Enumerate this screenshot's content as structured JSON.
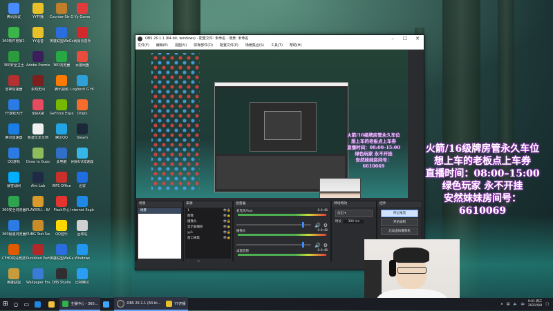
{
  "desktop": {
    "icons": [
      {
        "label": "腾讯会议",
        "color": "#4a8cff"
      },
      {
        "label": "YY开播",
        "color": "#e8c02a"
      },
      {
        "label": "Counter-Str Global Off...",
        "color": "#c07d2a"
      },
      {
        "label": "Yy Game",
        "color": "#e23b3b"
      },
      {
        "label": "360软件管家2.0",
        "color": "#3bb54a"
      },
      {
        "label": "YY语音",
        "color": "#e8c02a"
      },
      {
        "label": "英雄联盟WeGame",
        "color": "#2b6cdf"
      },
      {
        "label": "网易云音乐",
        "color": "#d3282c"
      },
      {
        "label": "360安全卫士",
        "color": "#2c9b3e"
      },
      {
        "label": "Adobe Premiere...",
        "color": "#3a1f5c"
      },
      {
        "label": "360浏览器",
        "color": "#28a745"
      },
      {
        "label": "百度网盘",
        "color": "#e94b3c"
      },
      {
        "label": "雷神加速器",
        "color": "#b53030"
      },
      {
        "label": "永劫无间",
        "color": "#7c1f1f"
      },
      {
        "label": "腾讯视频",
        "color": "#ff7a00"
      },
      {
        "label": "Logitech G HUB",
        "color": "#2f9fd8"
      },
      {
        "label": "YY游戏大厅",
        "color": "#2b7be4"
      },
      {
        "label": "全民K歌",
        "color": "#e84a5f"
      },
      {
        "label": "GeForce Experience",
        "color": "#76b900"
      },
      {
        "label": "Origin",
        "color": "#f56c2d"
      },
      {
        "label": "腾讯加速器",
        "color": "#1a7ee6"
      },
      {
        "label": "新建文本文档",
        "color": "#f0f0f0"
      },
      {
        "label": "腾讯QQ",
        "color": "#23a4e4"
      },
      {
        "label": "Steam",
        "color": "#1b2838"
      },
      {
        "label": "QQ游戏",
        "color": "#2c7be5"
      },
      {
        "label": "Draw to Guess",
        "color": "#8fbc5a"
      },
      {
        "label": "此电脑",
        "color": "#2f6fc7"
      },
      {
        "label": "网易UU加速器",
        "color": "#35b6e6"
      },
      {
        "label": "暴雪战网",
        "color": "#00aeff"
      },
      {
        "label": "Aim Lab",
        "color": "#1f2a44"
      },
      {
        "label": "WPS Office",
        "color": "#c8302b"
      },
      {
        "label": "迅雷",
        "color": "#1f6de0"
      },
      {
        "label": "360安全浏览器",
        "color": "#2ea44f"
      },
      {
        "label": "PLAYERU... BATTLEGR...",
        "color": "#d79a2b"
      },
      {
        "label": "Flash中心",
        "color": "#e3342f"
      },
      {
        "label": "Internet Explorer",
        "color": "#1e88e5"
      },
      {
        "label": "360极速浏览器",
        "color": "#2c7be5"
      },
      {
        "label": "PUBG Test Server",
        "color": "#c78d2a"
      },
      {
        "label": "QQ音乐",
        "color": "#ffd600"
      },
      {
        "label": "回收站",
        "color": "#d0d0d0"
      },
      {
        "label": "CFHD高清竞技大区",
        "color": "#e05a00"
      },
      {
        "label": "Punished Party",
        "color": "#b02828"
      },
      {
        "label": "英雄联盟WeGame",
        "color": "#2b6cdf"
      },
      {
        "label": "Windows",
        "color": "#2196f3"
      },
      {
        "label": "英雄联盟",
        "color": "#c89b3c"
      },
      {
        "label": "Wallpaper Engine",
        "color": "#3a7bd5"
      },
      {
        "label": "OBS Studio",
        "color": "#302e31"
      },
      {
        "label": "比特精灵",
        "color": "#2a9df4"
      }
    ]
  },
  "obs": {
    "title": "OBS 26.1.1 (64-bit, windows) - 配置文件: 未命名 - 场景: 未命名",
    "menu": [
      "文件(F)",
      "编辑(E)",
      "视图(V)",
      "停靠部件(D)",
      "配置文件(P)",
      "场景集合(S)",
      "工具(T)",
      "帮助(H)"
    ],
    "window_controls": [
      "–",
      "☐",
      "✕"
    ],
    "docks": {
      "scenes": {
        "title": "场景",
        "items": [
          "场景"
        ]
      },
      "sources": {
        "title": "来源",
        "items": [
          "1",
          "图像",
          "摄像头",
          "显示器捕获",
          "yy1",
          "窗口采集"
        ]
      },
      "mixer": {
        "title": "混音器",
        "channels": [
          {
            "name": "麦克风/Aux",
            "db": "0.0 dB"
          },
          {
            "name": "摄像头",
            "db": "0.0 dB"
          },
          {
            "name": "桌面音频",
            "db": "0.0 dB"
          }
        ]
      },
      "transitions": {
        "title": "转场特效",
        "type": "淡出",
        "duration_label": "时长",
        "duration": "300 ms"
      },
      "controls": {
        "title": "控件",
        "buttons": [
          "停止推流",
          "开始录制",
          "启动虚拟摄像机"
        ]
      }
    },
    "status": "LIVE: 00:00:00   REC: 00:00:00"
  },
  "preview": {
    "overlay_lines": [
      "火箭/16级牌房管永久车位",
      "想上车的老板点上车券",
      "直播时间：08:00–15:00",
      "绿色玩家 永不开挂",
      "安然妹妹房间号：",
      "6610069"
    ]
  },
  "overlay": {
    "lines": [
      "火箭/16级牌房管永久车位",
      "想上车的老板点上车券",
      "直播时间：08:00–15:00",
      "绿色玩家 永不开挂",
      "安然妹妹房间号：",
      "6610069"
    ]
  },
  "taskbar": {
    "apps": [
      {
        "label": "主播中心 - 360...",
        "color": "#2fb24a"
      },
      {
        "label": "",
        "color": "#3da7ff"
      },
      {
        "label": "OBS 26.1.1 (64-bi...",
        "color": "#3a3a3a"
      },
      {
        "label": "YY开播",
        "color": "#e8c02a"
      }
    ],
    "clock_time": "9:01 周三",
    "clock_date": "2021/9/8",
    "ime": "中"
  }
}
